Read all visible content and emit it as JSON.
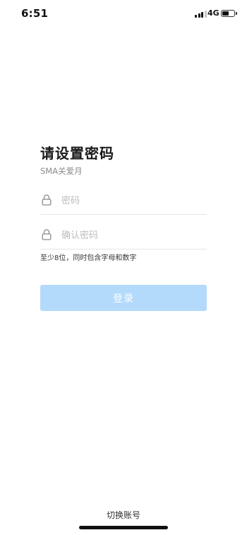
{
  "status_bar": {
    "time": "6:51",
    "network": "4G",
    "battery_level": 0.55,
    "signal_bars_active": 3,
    "signal_bars_total": 4
  },
  "page": {
    "title": "请设置密码",
    "subtitle": "SMA关爱月"
  },
  "form": {
    "password_placeholder": "密码",
    "confirm_password_placeholder": "确认密码",
    "password_value": "",
    "confirm_password_value": "",
    "hint": "至少8位，同时包含字母和数字",
    "submit_label": "登录"
  },
  "footer": {
    "switch_account_label": "切换账号"
  },
  "colors": {
    "button_disabled_bg": "#b3dafb",
    "placeholder": "#bdbdbd",
    "divider": "#e5e5e5"
  },
  "icons": {
    "signal": "cellular-signal-icon",
    "battery": "battery-icon",
    "field_lock": "lock-icon"
  }
}
